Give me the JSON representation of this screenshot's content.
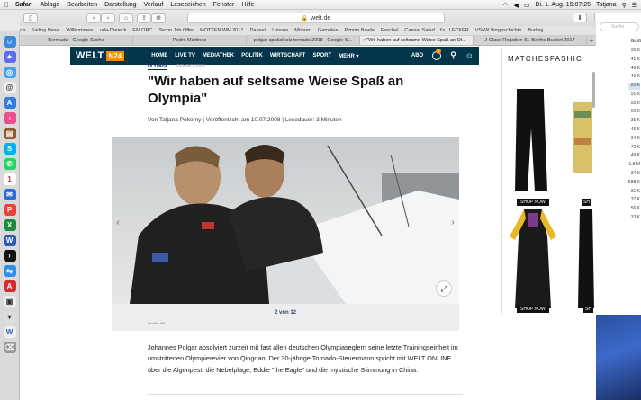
{
  "menubar": {
    "app": "Safari",
    "items": [
      "Ablage",
      "Bearbeiten",
      "Darstellung",
      "Verlauf",
      "Lesezeichen",
      "Fenster",
      "Hilfe"
    ],
    "clock": "Di. 1. Aug.  15:07:25",
    "user": "Tatjana"
  },
  "toolbar": {
    "url": "welt.de"
  },
  "bookmarks": [
    "c's ...Sailing News",
    "Willkommen i...uda-Dreieck",
    "EM ORC",
    "Techn Job Offer",
    "MOTTEN WM 2017",
    "Daune!",
    "Limone",
    "Möhren",
    "Garnelen",
    "Pimms Bowle",
    "Fenchel",
    "Caesar Salad ...t's | LECKER",
    "VSaW Vorgeschichte",
    "Burling"
  ],
  "tabs": [
    {
      "label": "Bermuda - Google-Suche",
      "active": false
    },
    {
      "label": "Pedro Martinez",
      "active": false
    },
    {
      "label": "polgar spatialholz tornado 2008 - Google-S...",
      "active": false
    },
    {
      "label": "\"Wir haben auf seltsame Weise Spaß an Ol...",
      "active": true
    },
    {
      "label": "J-Class Regatten St. Barths-Bucket 2017",
      "active": false
    }
  ],
  "welt": {
    "logo": "WELT",
    "logo_badge": "N24",
    "nav": [
      "HOME",
      "LIVE TV",
      "MEDIATHEK",
      "POLITIK",
      "WIRTSCHAFT",
      "SPORT",
      "MEHR ▾"
    ],
    "abo": "ABO",
    "notif_count": "1"
  },
  "article": {
    "kicker": "OLYMPIA",
    "kicker_sub": "PEKING 2008",
    "headline": "\"Wir haben auf seltsame Weise Spaß an Olympia\"",
    "byline": "Von Tatjana Pokorny | Veröffentlicht am 10.07.2008 | Lesedauer: 3 Minuten",
    "gallery_counter": "2 von 12",
    "photo_source": "Quelle: AP",
    "body": "Johannes Polgar absolviert zurzeit mit fast allen deutschen Olympiaseglern seine letzte Trainingseinheit im umstrittenen Olympierevier von Qingdao. Der 30-jährige Tornado-Steuermann spricht mit WELT ONLINE über die Algenpest, die Nebelplage, Eddie \"the Eagle\" und die mystische Stimmung in China."
  },
  "ad": {
    "brand": "MATCHESFASHIC",
    "shop_label": "SHOP NOW"
  },
  "bgwin": {
    "search_placeholder": "Suche",
    "header": "Größ",
    "values": [
      "35 K",
      "41 K",
      "46 K",
      "46 K",
      "25 K",
      "51 K",
      "53 K",
      "60 K",
      "35 K",
      "46 K",
      "34 K",
      "72 K",
      "49 K",
      "1,8 M",
      "34 K",
      "588 K",
      "31 K",
      "37 K",
      "56 K",
      "33 K"
    ]
  },
  "colors": {
    "welt_navy": "#03364b",
    "n24_orange": "#f39000"
  }
}
